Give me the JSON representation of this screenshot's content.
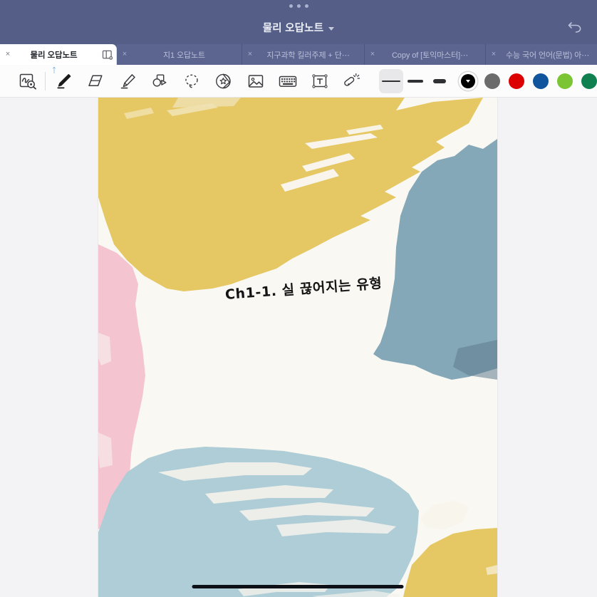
{
  "window": {
    "grip": "drag-handle-dots",
    "title": "물리 오답노트",
    "title_chevron": "chevron-down-icon",
    "undo_icon": "undo-arrow-icon",
    "titlebar_color": "#545e86"
  },
  "tabs": [
    {
      "label": "물리 오답노트",
      "close": "×",
      "active": true,
      "panel_icon": "side-panel-icon"
    },
    {
      "label": "지1 오답노트",
      "close": "×",
      "active": false
    },
    {
      "label": "지구과학 킬러주제 + 단⋯",
      "close": "×",
      "active": false
    },
    {
      "label": "Copy of [토익마스터]⋯",
      "close": "×",
      "active": false
    },
    {
      "label": "수능 국어 언어(문법) 아⋯",
      "close": "×",
      "active": false
    }
  ],
  "toolbar": {
    "tools": [
      {
        "name": "search-handwriting-icon",
        "label": "Search handwriting",
        "selected": false
      },
      {
        "name": "pen-icon",
        "label": "Pen",
        "selected": true,
        "badge": "bluetooth-icon"
      },
      {
        "name": "eraser-icon",
        "label": "Eraser",
        "selected": false
      },
      {
        "name": "highlighter-icon",
        "label": "Highlighter",
        "selected": false
      },
      {
        "name": "shapes-icon",
        "label": "Shapes",
        "selected": false
      },
      {
        "name": "lasso-select-icon",
        "label": "Lasso select",
        "selected": false
      },
      {
        "name": "sticker-icon",
        "label": "Sticker",
        "selected": false
      },
      {
        "name": "image-icon",
        "label": "Insert image",
        "selected": false
      },
      {
        "name": "keyboard-icon",
        "label": "Keyboard",
        "selected": false
      },
      {
        "name": "text-box-icon",
        "label": "Text box",
        "selected": false
      },
      {
        "name": "magic-wand-icon",
        "label": "Magic tool",
        "selected": false
      }
    ],
    "stroke_widths": [
      {
        "name": "stroke-thin",
        "selected": true
      },
      {
        "name": "stroke-medium",
        "selected": false
      },
      {
        "name": "stroke-thick",
        "selected": false
      }
    ],
    "colors": [
      {
        "name": "color-black",
        "hex": "#000000",
        "selected": true
      },
      {
        "name": "color-gray",
        "hex": "#6b6b6b",
        "selected": false
      },
      {
        "name": "color-red",
        "hex": "#dd0000",
        "selected": false
      },
      {
        "name": "color-blue",
        "hex": "#11549e",
        "selected": false
      },
      {
        "name": "color-light-green",
        "hex": "#7bc534",
        "selected": false
      },
      {
        "name": "color-dark-green",
        "hex": "#108050",
        "selected": false
      }
    ]
  },
  "page": {
    "handwriting": "Ch1-1. 실 끊어지는 유형",
    "background_name": "watercolor-brush-cover",
    "paper_color": "#faf8f3",
    "palette": {
      "yellow": "#e5c863",
      "pink": "#f4c4d0",
      "slate_blue": "#85a8b8",
      "light_blue": "#aecdd6",
      "cream": "#f7f4ec"
    }
  },
  "system": {
    "home_indicator": "home-indicator-bar"
  }
}
